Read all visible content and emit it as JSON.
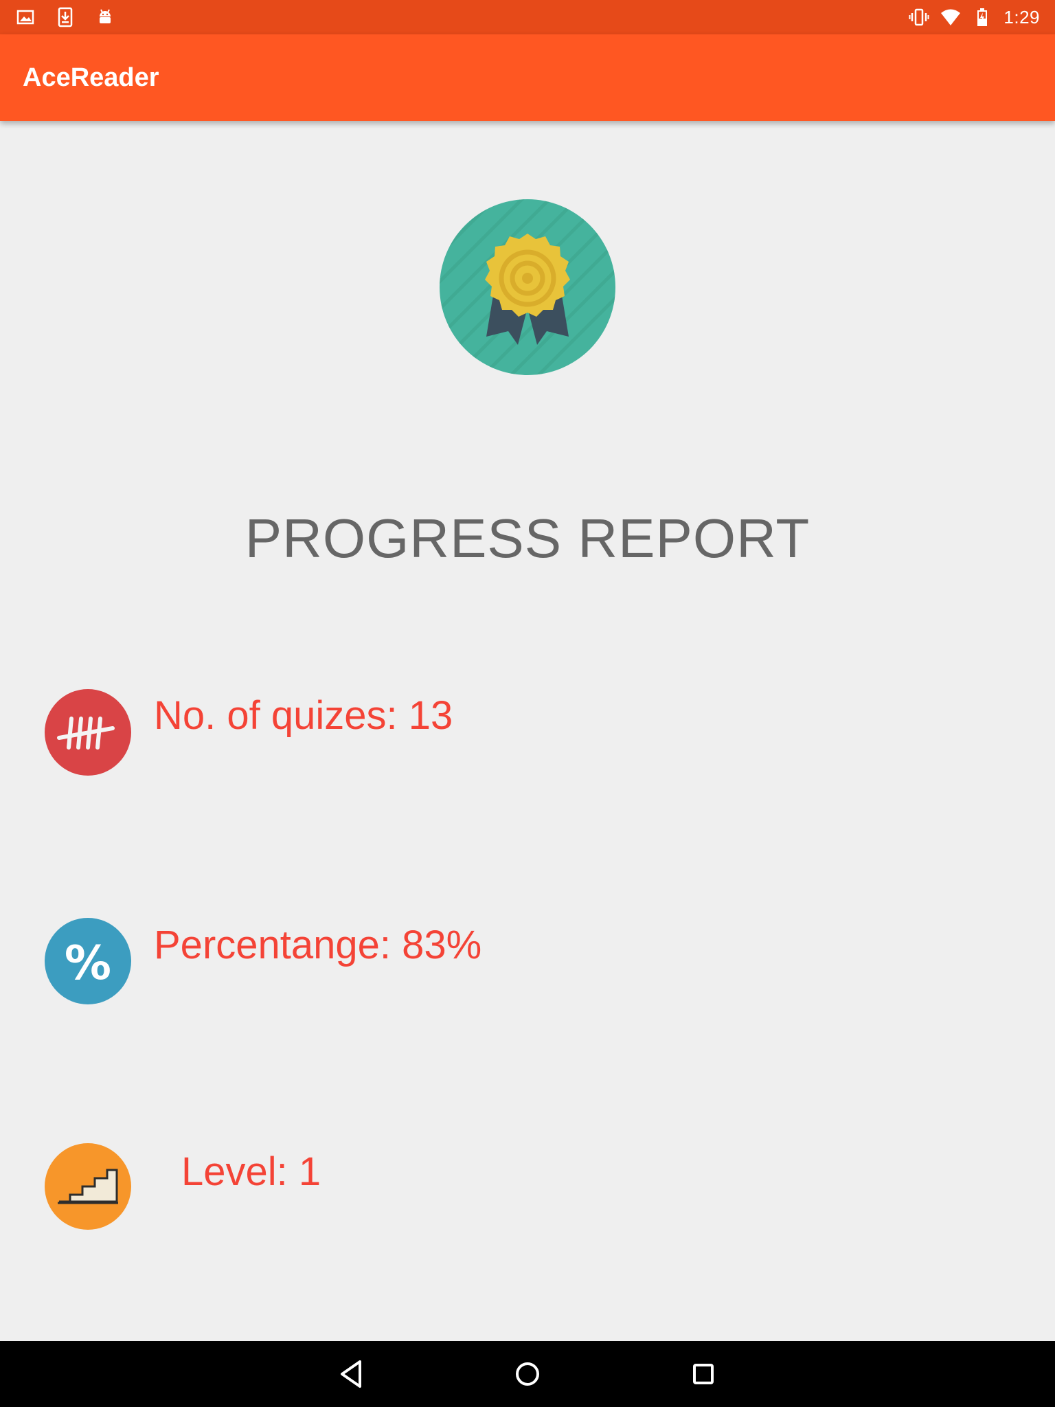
{
  "status_bar": {
    "time": "1:29",
    "left_icons": [
      "gallery-icon",
      "download-icon",
      "android-icon"
    ],
    "right_icons": [
      "vibrate-icon",
      "wifi-icon",
      "battery-icon"
    ]
  },
  "app_bar": {
    "title": "AceReader"
  },
  "colors": {
    "status_bar": "#e64a19",
    "app_bar": "#ff5722",
    "stat_text": "#f44336",
    "report_title": "#666666"
  },
  "badge": {
    "icon": "award-medal-icon"
  },
  "report": {
    "title": "PROGRESS REPORT",
    "stats": [
      {
        "icon": "tally-marks-icon",
        "text": "No. of quizes: 13"
      },
      {
        "icon": "percent-icon",
        "text": "Percentange: 83%"
      },
      {
        "icon": "stairs-icon",
        "text": "Level: 1"
      }
    ]
  },
  "nav_bar": {
    "buttons": [
      "back-icon",
      "home-icon",
      "recents-icon"
    ]
  }
}
